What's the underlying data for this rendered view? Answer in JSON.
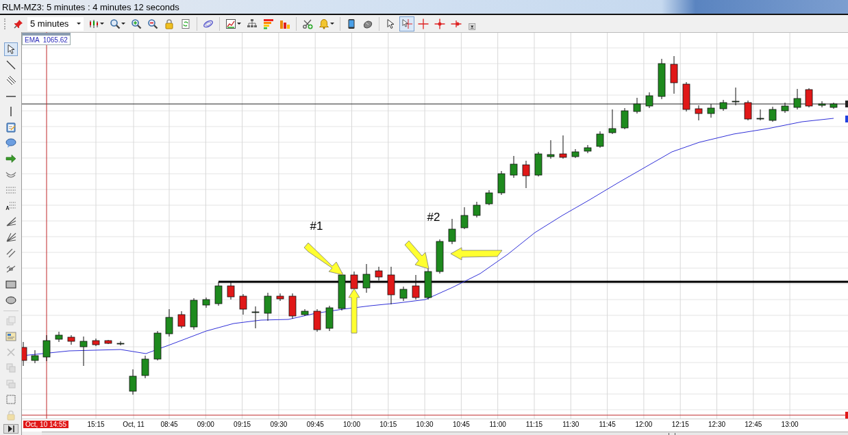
{
  "window": {
    "title": "RLM-MZ3: 5 minutes : 4 minutes 12 seconds"
  },
  "toolbar": {
    "interval": "5 minutes",
    "groups": [
      [
        {
          "kind": "candles",
          "caret": true,
          "selected": false
        },
        {
          "kind": "magnifier",
          "caret": true,
          "selected": false
        },
        {
          "kind": "zoom-in",
          "caret": false,
          "selected": false
        },
        {
          "kind": "zoom-out",
          "caret": false,
          "selected": false
        },
        {
          "kind": "lock",
          "caret": false,
          "selected": false
        },
        {
          "kind": "refresh",
          "caret": false,
          "selected": false
        }
      ],
      [
        {
          "kind": "orbit",
          "caret": false,
          "selected": false
        }
      ],
      [
        {
          "kind": "chart-window",
          "caret": true,
          "selected": false
        },
        {
          "kind": "hierarchy",
          "caret": false,
          "selected": false
        },
        {
          "kind": "bars-horizontal",
          "caret": false,
          "selected": false
        },
        {
          "kind": "bars-vertical",
          "caret": false,
          "selected": false
        }
      ],
      [
        {
          "kind": "scissors-plus",
          "caret": false,
          "selected": false
        },
        {
          "kind": "bell",
          "caret": true,
          "selected": false
        }
      ],
      [
        {
          "kind": "phone",
          "caret": false,
          "selected": false
        },
        {
          "kind": "mouse",
          "caret": false,
          "selected": false
        }
      ],
      [
        {
          "kind": "pointer",
          "caret": false,
          "selected": false
        },
        {
          "kind": "crosshair-pointer",
          "caret": false,
          "selected": true
        },
        {
          "kind": "crosshair",
          "caret": false,
          "selected": false
        },
        {
          "kind": "crosshair-dot",
          "caret": false,
          "selected": false
        },
        {
          "kind": "crosshair-dot-right",
          "caret": false,
          "selected": false
        }
      ]
    ]
  },
  "drawing_tools": [
    {
      "kind": "pointer",
      "selected": true,
      "disabled": false
    },
    {
      "kind": "line",
      "selected": false,
      "disabled": false
    },
    {
      "kind": "parallel-lines",
      "selected": false,
      "disabled": false
    },
    {
      "kind": "horizontal-line",
      "selected": false,
      "disabled": false
    },
    {
      "kind": "vertical-line",
      "selected": false,
      "disabled": false
    },
    {
      "kind": "note",
      "selected": false,
      "disabled": false
    },
    {
      "kind": "speech-bubble",
      "selected": false,
      "disabled": false
    },
    {
      "kind": "arrow",
      "selected": false,
      "disabled": false
    },
    {
      "kind": "arc",
      "selected": false,
      "disabled": false
    },
    {
      "kind": "dotted-lines",
      "selected": false,
      "disabled": false
    },
    {
      "kind": "fibonacci",
      "selected": false,
      "disabled": false
    },
    {
      "kind": "fan",
      "selected": false,
      "disabled": false
    },
    {
      "kind": "gann",
      "selected": false,
      "disabled": false
    },
    {
      "kind": "fan-lines",
      "selected": false,
      "disabled": false
    },
    {
      "kind": "channel",
      "selected": false,
      "disabled": false
    },
    {
      "kind": "rectangle",
      "selected": false,
      "disabled": false
    },
    {
      "kind": "ellipse",
      "selected": false,
      "disabled": false
    },
    {
      "kind": "layers",
      "selected": false,
      "disabled": true
    },
    {
      "kind": "table",
      "selected": false,
      "disabled": false
    },
    {
      "kind": "delete",
      "selected": false,
      "disabled": true
    },
    {
      "kind": "copy",
      "selected": false,
      "disabled": true
    },
    {
      "kind": "paste",
      "selected": false,
      "disabled": true
    },
    {
      "kind": "select-area",
      "selected": false,
      "disabled": false
    },
    {
      "kind": "lock",
      "selected": false,
      "disabled": true
    }
  ],
  "chart": {
    "indicator": "EMA  1065.62",
    "annotations": [
      "#1",
      "#2"
    ],
    "time_axis": [
      {
        "label": "Oct, 10 14:55",
        "highlighted": true
      },
      {
        "label": "15:15",
        "highlighted": false
      },
      {
        "label": "Oct, 11",
        "highlighted": false
      },
      {
        "label": "08:45",
        "highlighted": false
      },
      {
        "label": "09:00",
        "highlighted": false
      },
      {
        "label": "09:15",
        "highlighted": false
      },
      {
        "label": "09:30",
        "highlighted": false
      },
      {
        "label": "09:45",
        "highlighted": false
      },
      {
        "label": "10:00",
        "highlighted": false
      },
      {
        "label": "10:15",
        "highlighted": false
      },
      {
        "label": "10:30",
        "highlighted": false
      },
      {
        "label": "10:45",
        "highlighted": false
      },
      {
        "label": "11:00",
        "highlighted": false
      },
      {
        "label": "11:15",
        "highlighted": false
      },
      {
        "label": "11:30",
        "highlighted": false
      },
      {
        "label": "11:45",
        "highlighted": false
      },
      {
        "label": "12:00",
        "highlighted": false
      },
      {
        "label": "12:15",
        "highlighted": false
      },
      {
        "label": "12:30",
        "highlighted": false
      },
      {
        "label": "12:45",
        "highlighted": false
      },
      {
        "label": "13:00",
        "highlighted": false
      }
    ]
  }
}
